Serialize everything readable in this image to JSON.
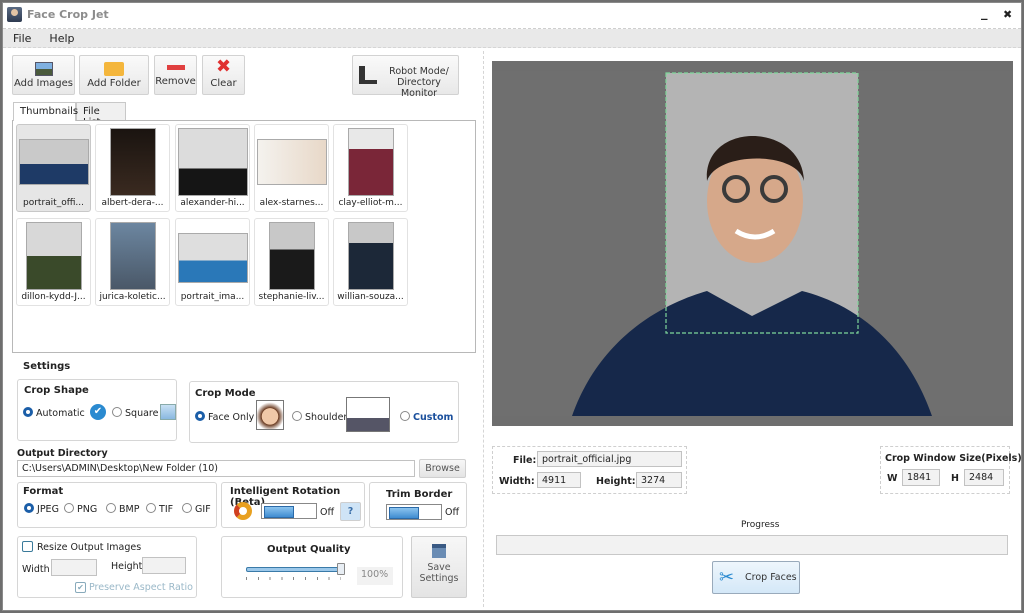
{
  "window": {
    "title": "Face Crop Jet",
    "minimize_glyph": "_",
    "close_glyph": "✖"
  },
  "menu": [
    "File",
    "Help"
  ],
  "toolbar": {
    "add_images": "Add Images",
    "add_folder": "Add Folder",
    "remove": "Remove",
    "clear": "Clear",
    "robot_mode_line1": "Robot Mode/",
    "robot_mode_line2": "Directory Monitor"
  },
  "tabs": [
    {
      "label": "Thumbnails",
      "active": true
    },
    {
      "label": "File List",
      "active": false
    }
  ],
  "thumbnails": [
    {
      "caption": "portrait_offi...",
      "selected": true
    },
    {
      "caption": "albert-dera-..."
    },
    {
      "caption": "alexander-hi..."
    },
    {
      "caption": "alex-starnes..."
    },
    {
      "caption": "clay-elliot-m..."
    },
    {
      "caption": "dillon-kydd-J..."
    },
    {
      "caption": "jurica-koletic..."
    },
    {
      "caption": "portrait_ima..."
    },
    {
      "caption": "stephanie-liv..."
    },
    {
      "caption": "willian-souza..."
    }
  ],
  "settings": {
    "heading": "Settings",
    "crop_shape": {
      "title": "Crop Shape",
      "automatic": "Automatic",
      "square": "Square",
      "selected": "Automatic"
    },
    "crop_mode": {
      "title": "Crop Mode",
      "face_only": "Face Only",
      "shoulder": "Shoulder",
      "custom": "Custom",
      "selected": "Face Only"
    },
    "output_directory": {
      "label": "Output Directory",
      "value": "C:\\Users\\ADMIN\\Desktop\\New Folder (10)",
      "browse": "Browse"
    },
    "format": {
      "title": "Format",
      "options": [
        "JPEG",
        "PNG",
        "BMP",
        "TIF",
        "GIF"
      ],
      "selected": "JPEG"
    },
    "intelligent_rotation": {
      "title": "Intelligent Rotation (Beta)",
      "state": "Off",
      "help": "?"
    },
    "trim_border": {
      "title": "Trim Border",
      "state": "Off"
    },
    "resize": {
      "label": "Resize Output Images",
      "checked": false,
      "width_label": "Width",
      "height_label": "Height",
      "width": "",
      "height": "",
      "preserve": "Preserve Aspect Ratio",
      "preserve_checked": true
    },
    "output_quality": {
      "title": "Output Quality",
      "value": "100%",
      "fraction": 1.0
    },
    "save_settings_line1": "Save",
    "save_settings_line2": "Settings"
  },
  "file_info": {
    "file_label": "File:",
    "file": "portrait_official.jpg",
    "width_label": "Width:",
    "width": "4911",
    "height_label": "Height:",
    "height": "3274"
  },
  "crop_window": {
    "title": "Crop Window Size(Pixels)",
    "w_label": "W",
    "w": "1841",
    "h_label": "H",
    "h": "2484"
  },
  "progress": {
    "label": "Progress",
    "value": 0
  },
  "crop_faces": "Crop Faces",
  "colors": {
    "accent": "#1b5ea8",
    "crop_box": "#7ed69a",
    "custom_link": "#1a4f9c"
  }
}
